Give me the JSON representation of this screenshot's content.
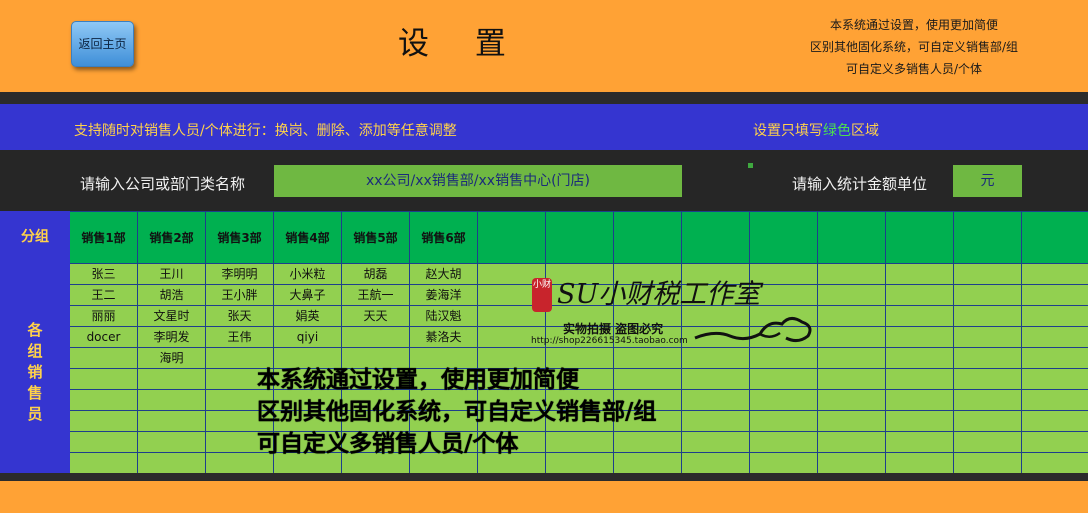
{
  "header": {
    "home_button": "返回主页",
    "title": "设 置",
    "notes": [
      "本系统通过设置，使用更加简便",
      "区别其他固化系统，可自定义销售部/组",
      "可自定义多销售人员/个体"
    ]
  },
  "banner": {
    "left_text": "支持随时对销售人员/个体进行：换岗、删除、添加等任意调整",
    "right_prefix": "设置只填写",
    "right_green": "绿色",
    "right_suffix": "区域"
  },
  "settings": {
    "company_label": "请输入公司或部门类名称",
    "company_value": "xx公司/xx销售部/xx销售中心(门店)",
    "unit_label": "请输入统计金额单位",
    "unit_value": "元"
  },
  "side": {
    "group_label": "分组",
    "sales_label": "各组销售员"
  },
  "table": {
    "headers": [
      "销售1部",
      "销售2部",
      "销售3部",
      "销售4部",
      "销售5部",
      "销售6部",
      "",
      "",
      "",
      "",
      "",
      "",
      "",
      "",
      ""
    ],
    "rows": [
      [
        "张三",
        "王川",
        "李明明",
        "小米粒",
        "胡磊",
        "赵大胡"
      ],
      [
        "王二",
        "胡浩",
        "王小胖",
        "大鼻子",
        "王航一",
        "姜海洋"
      ],
      [
        "丽丽",
        "文星时",
        "张天",
        "娟英",
        "天天",
        "陆汉魁"
      ],
      [
        "docer",
        "李明发",
        "王伟",
        "qiyi",
        "",
        "綦洛夫"
      ],
      [
        "",
        "海明",
        "",
        "",
        "",
        ""
      ],
      [
        "",
        "",
        "",
        "",
        "",
        ""
      ],
      [
        "",
        "",
        "",
        "",
        "",
        ""
      ],
      [
        "",
        "",
        "",
        "",
        "",
        ""
      ],
      [
        "",
        "",
        "",
        "",
        "",
        ""
      ],
      [
        "",
        "",
        "",
        "",
        "",
        ""
      ]
    ]
  },
  "watermark": {
    "stamp": "小财",
    "logo": "SU小财税工作室",
    "sub": "实物拍摄 盗图必究",
    "url": "http://shop226615345.taobao.com"
  },
  "overlay": [
    "本系统通过设置，使用更加简便",
    "区别其他固化系统，可自定义销售部/组",
    "可自定义多销售人员/个体"
  ]
}
